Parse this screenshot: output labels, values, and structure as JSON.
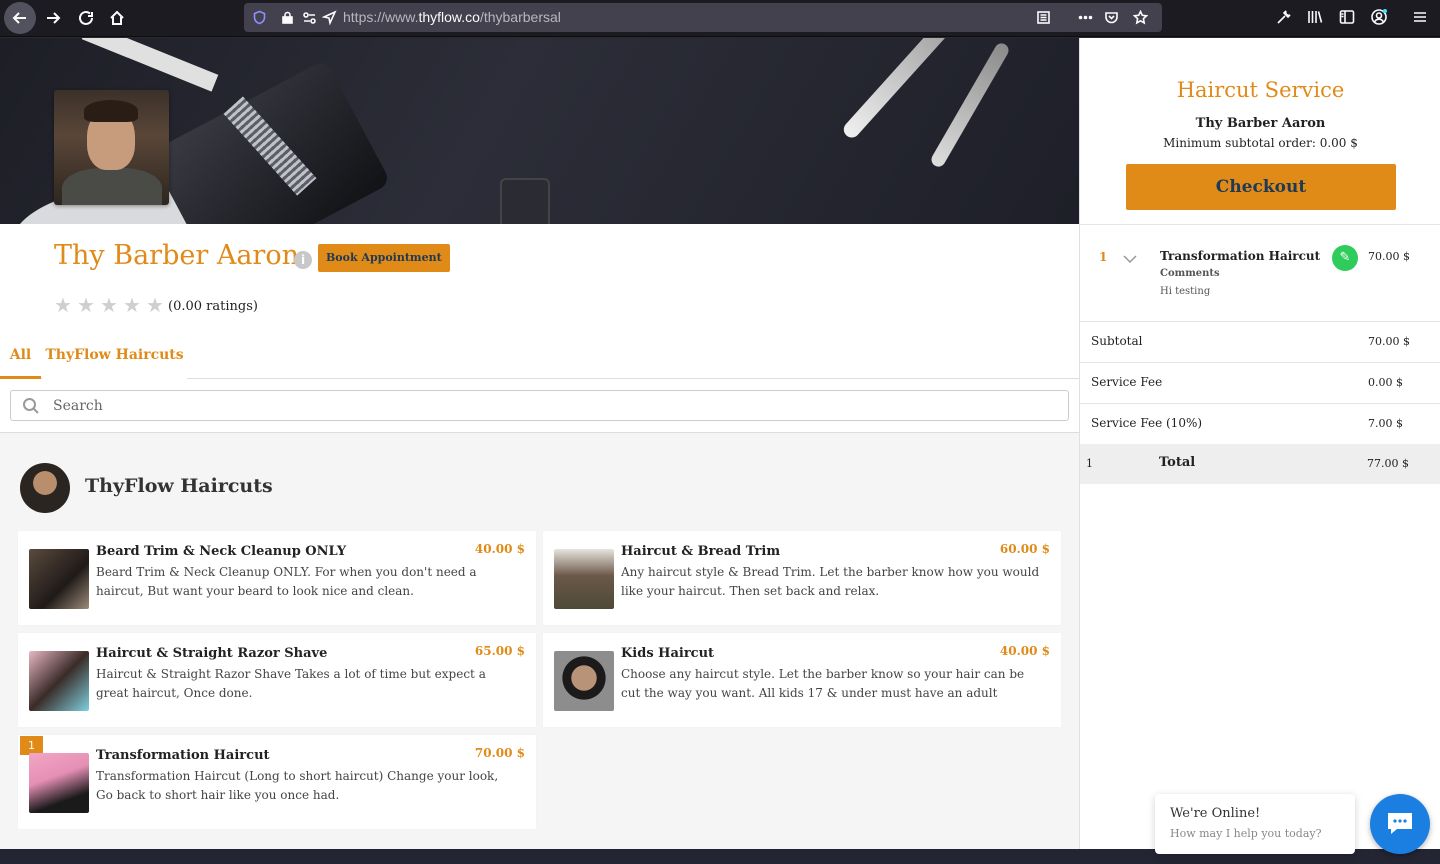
{
  "browser": {
    "url_prefix": "https://www.",
    "url_domain": "thyflow.co",
    "url_path": "/thybarbersal"
  },
  "profile": {
    "shop_name": "Thy Barber Aaron",
    "book_label": "Book Appointment",
    "info_glyph": "i",
    "rating_value": 0,
    "rating_text": "(0.00 ratings)"
  },
  "tabs": [
    {
      "label": "All"
    },
    {
      "label": "ThyFlow Haircuts"
    }
  ],
  "search": {
    "placeholder": "Search"
  },
  "category": {
    "title": "ThyFlow Haircuts"
  },
  "services": [
    {
      "name": "Beard Trim & Neck Cleanup ONLY",
      "price": "40.00 $",
      "desc": "Beard Trim & Neck Cleanup ONLY. For when you don't need a haircut, But want your beard to look nice and clean.",
      "qty": ""
    },
    {
      "name": "Haircut & Bread Trim",
      "price": "60.00 $",
      "desc": "Any haircut style & Bread Trim. Let the barber know how you would like your haircut. Then set back and relax.",
      "qty": ""
    },
    {
      "name": "Haircut & Straight Razor Shave",
      "price": "65.00 $",
      "desc": "Haircut & Straight Razor Shave Takes a lot of time but expect a great haircut, Once done.",
      "qty": ""
    },
    {
      "name": "Kids Haircut",
      "price": "40.00 $",
      "desc": "Choose any haircut style. Let the barber know so your hair can be cut the way you want. All kids 17 & under must have an adult present at location of",
      "qty": ""
    },
    {
      "name": "Transformation Haircut",
      "price": "70.00 $",
      "desc": "Transformation Haircut (Long to short haircut) Change your look, Go back to short hair like you once had.",
      "qty": "1"
    }
  ],
  "cart": {
    "title": "Haircut Service",
    "shop": "Thy Barber Aaron",
    "min_order": "Minimum subtotal order: 0.00 $",
    "checkout_label": "Checkout",
    "item": {
      "qty": "1",
      "name": "Transformation Haircut",
      "comments_label": "Comments",
      "comment": "Hi testing",
      "price": "70.00 $",
      "edit_glyph": "✎"
    },
    "summary": [
      {
        "label": "Subtotal",
        "value": "70.00 $"
      },
      {
        "label": "Service Fee",
        "value": "0.00 $"
      },
      {
        "label": "Service Fee (10%)",
        "value": "7.00 $"
      }
    ],
    "total": {
      "qty": "1",
      "label": "Total",
      "value": "77.00 $"
    }
  },
  "chat": {
    "title": "We're Online!",
    "subtitle": "How may I help you today?"
  },
  "colors": {
    "accent": "#e08a18",
    "button_text": "#1f3a55",
    "edit_green": "#2ecc5a",
    "chat_blue": "#1a7fe0"
  }
}
